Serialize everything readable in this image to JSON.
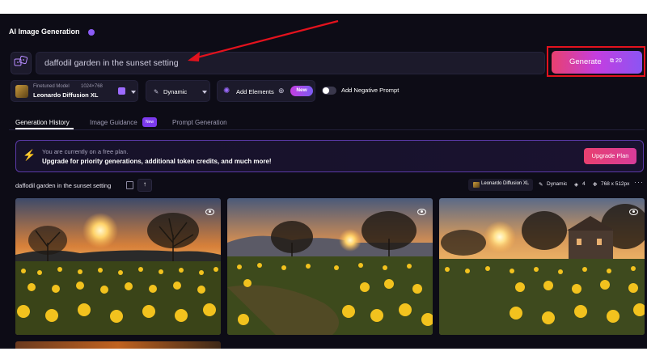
{
  "page": {
    "title": "AI Image Generation"
  },
  "prompt": {
    "value": "daffodil garden in the sunset setting"
  },
  "generate": {
    "label": "Generate",
    "tokens": "20"
  },
  "controls": {
    "model_caption": "Finetuned Model",
    "model_size": "1024×768",
    "model_name": "Leonardo Diffusion XL",
    "style": "Dynamic",
    "add_elements": "Add Elements",
    "new_badge": "New",
    "negative_prompt": "Add Negative Prompt"
  },
  "tabs": [
    {
      "label": "Generation History",
      "active": true
    },
    {
      "label": "Image Guidance",
      "badge": "New"
    },
    {
      "label": "Prompt Generation"
    }
  ],
  "banner": {
    "line1": "You are currently on a free plan.",
    "line2": "Upgrade for priority generations, additional token credits, and much more!",
    "button": "Upgrade Plan"
  },
  "generation": {
    "prompt": "daffodil garden in the sunset setting",
    "model": "Leonardo Diffusion XL",
    "style": "Dynamic",
    "count": "4",
    "size": "768 x 512px"
  },
  "icons": [
    "info-icon",
    "dice-icon",
    "token-icon",
    "style-icon",
    "elements-icon",
    "plus-icon",
    "bolt-icon",
    "copy-icon",
    "upload-icon",
    "grid-icon",
    "size-icon",
    "more-icon",
    "eye-icon"
  ],
  "colors": {
    "accent": "#8b55f3",
    "annotation": "#e3121d",
    "background": "#0d0c16"
  }
}
